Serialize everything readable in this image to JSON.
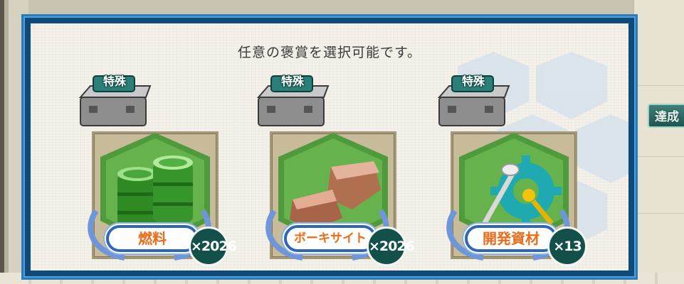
{
  "title": "任意の褒賞を選択可能です。",
  "side_tag": "達成",
  "colors": {
    "frame_blue": "#0f4a78",
    "label_orange": "#ef6a16",
    "count_bg": "#14504a"
  },
  "rewards": [
    {
      "badge": "特殊",
      "name": "燃料",
      "count": "×2026",
      "icon": "fuel-barrels-icon"
    },
    {
      "badge": "特殊",
      "name": "ボーキサイト",
      "count": "×2026",
      "icon": "bauxite-icon"
    },
    {
      "badge": "特殊",
      "name": "開発資材",
      "count": "×13",
      "icon": "development-material-icon"
    }
  ]
}
